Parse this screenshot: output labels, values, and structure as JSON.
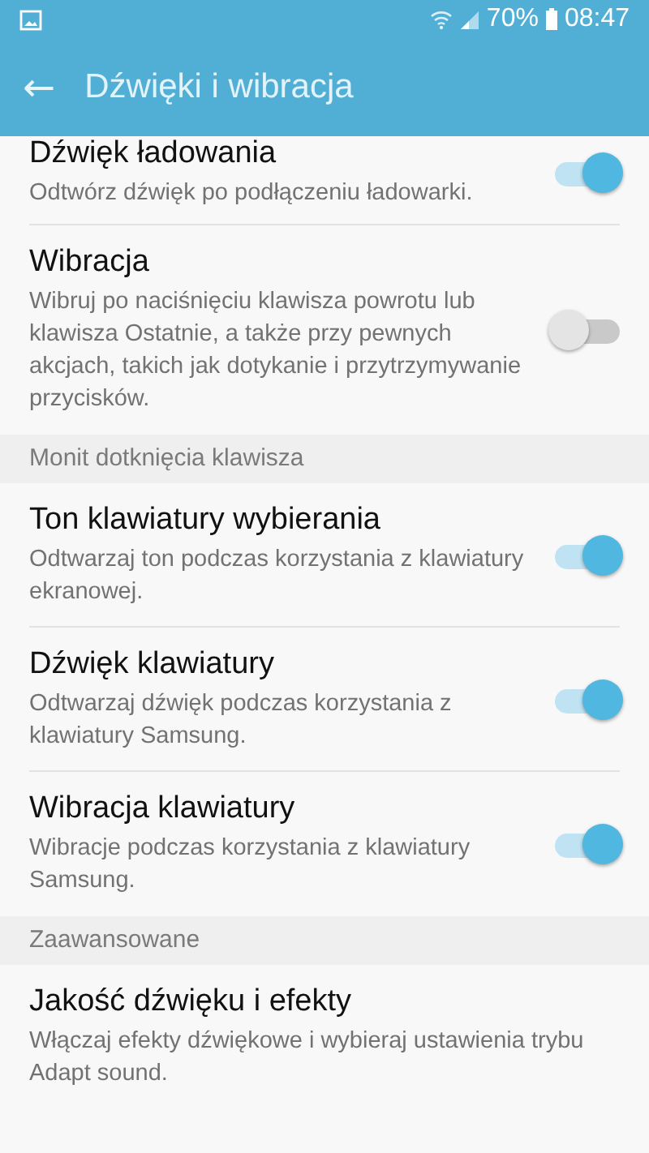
{
  "status_bar": {
    "battery": "70%",
    "time": "08:47"
  },
  "app_bar": {
    "back": "←",
    "title": "Dźwięki i wibracja"
  },
  "items": [
    {
      "kind": "setting",
      "title": "Dźwięk ładowania",
      "summary": "Odtwórz dźwięk po podłączeniu ładowarki.",
      "on": true
    },
    {
      "kind": "setting",
      "title": "Wibracja",
      "summary": "Wibruj po naciśnięciu klawisza powrotu lub klawisza Ostatnie, a także przy pewnych akcjach, takich jak dotykanie i przytrzymywanie przycisków.",
      "on": false
    },
    {
      "kind": "header",
      "title": "Monit dotknięcia klawisza"
    },
    {
      "kind": "setting",
      "title": "Ton klawiatury wybierania",
      "summary": "Odtwarzaj ton podczas korzystania z klawiatury ekranowej.",
      "on": true
    },
    {
      "kind": "setting",
      "title": "Dźwięk klawiatury",
      "summary": "Odtwarzaj dźwięk podczas korzystania z klawiatury Samsung.",
      "on": true
    },
    {
      "kind": "setting",
      "title": "Wibracja klawiatury",
      "summary": "Wibracje podczas korzystania z klawiatury Samsung.",
      "on": true
    },
    {
      "kind": "header",
      "title": "Zaawansowane"
    },
    {
      "kind": "link",
      "title": "Jakość dźwięku i efekty",
      "summary": "Włączaj efekty dźwiękowe i wybieraj ustawienia trybu Adapt sound."
    }
  ]
}
